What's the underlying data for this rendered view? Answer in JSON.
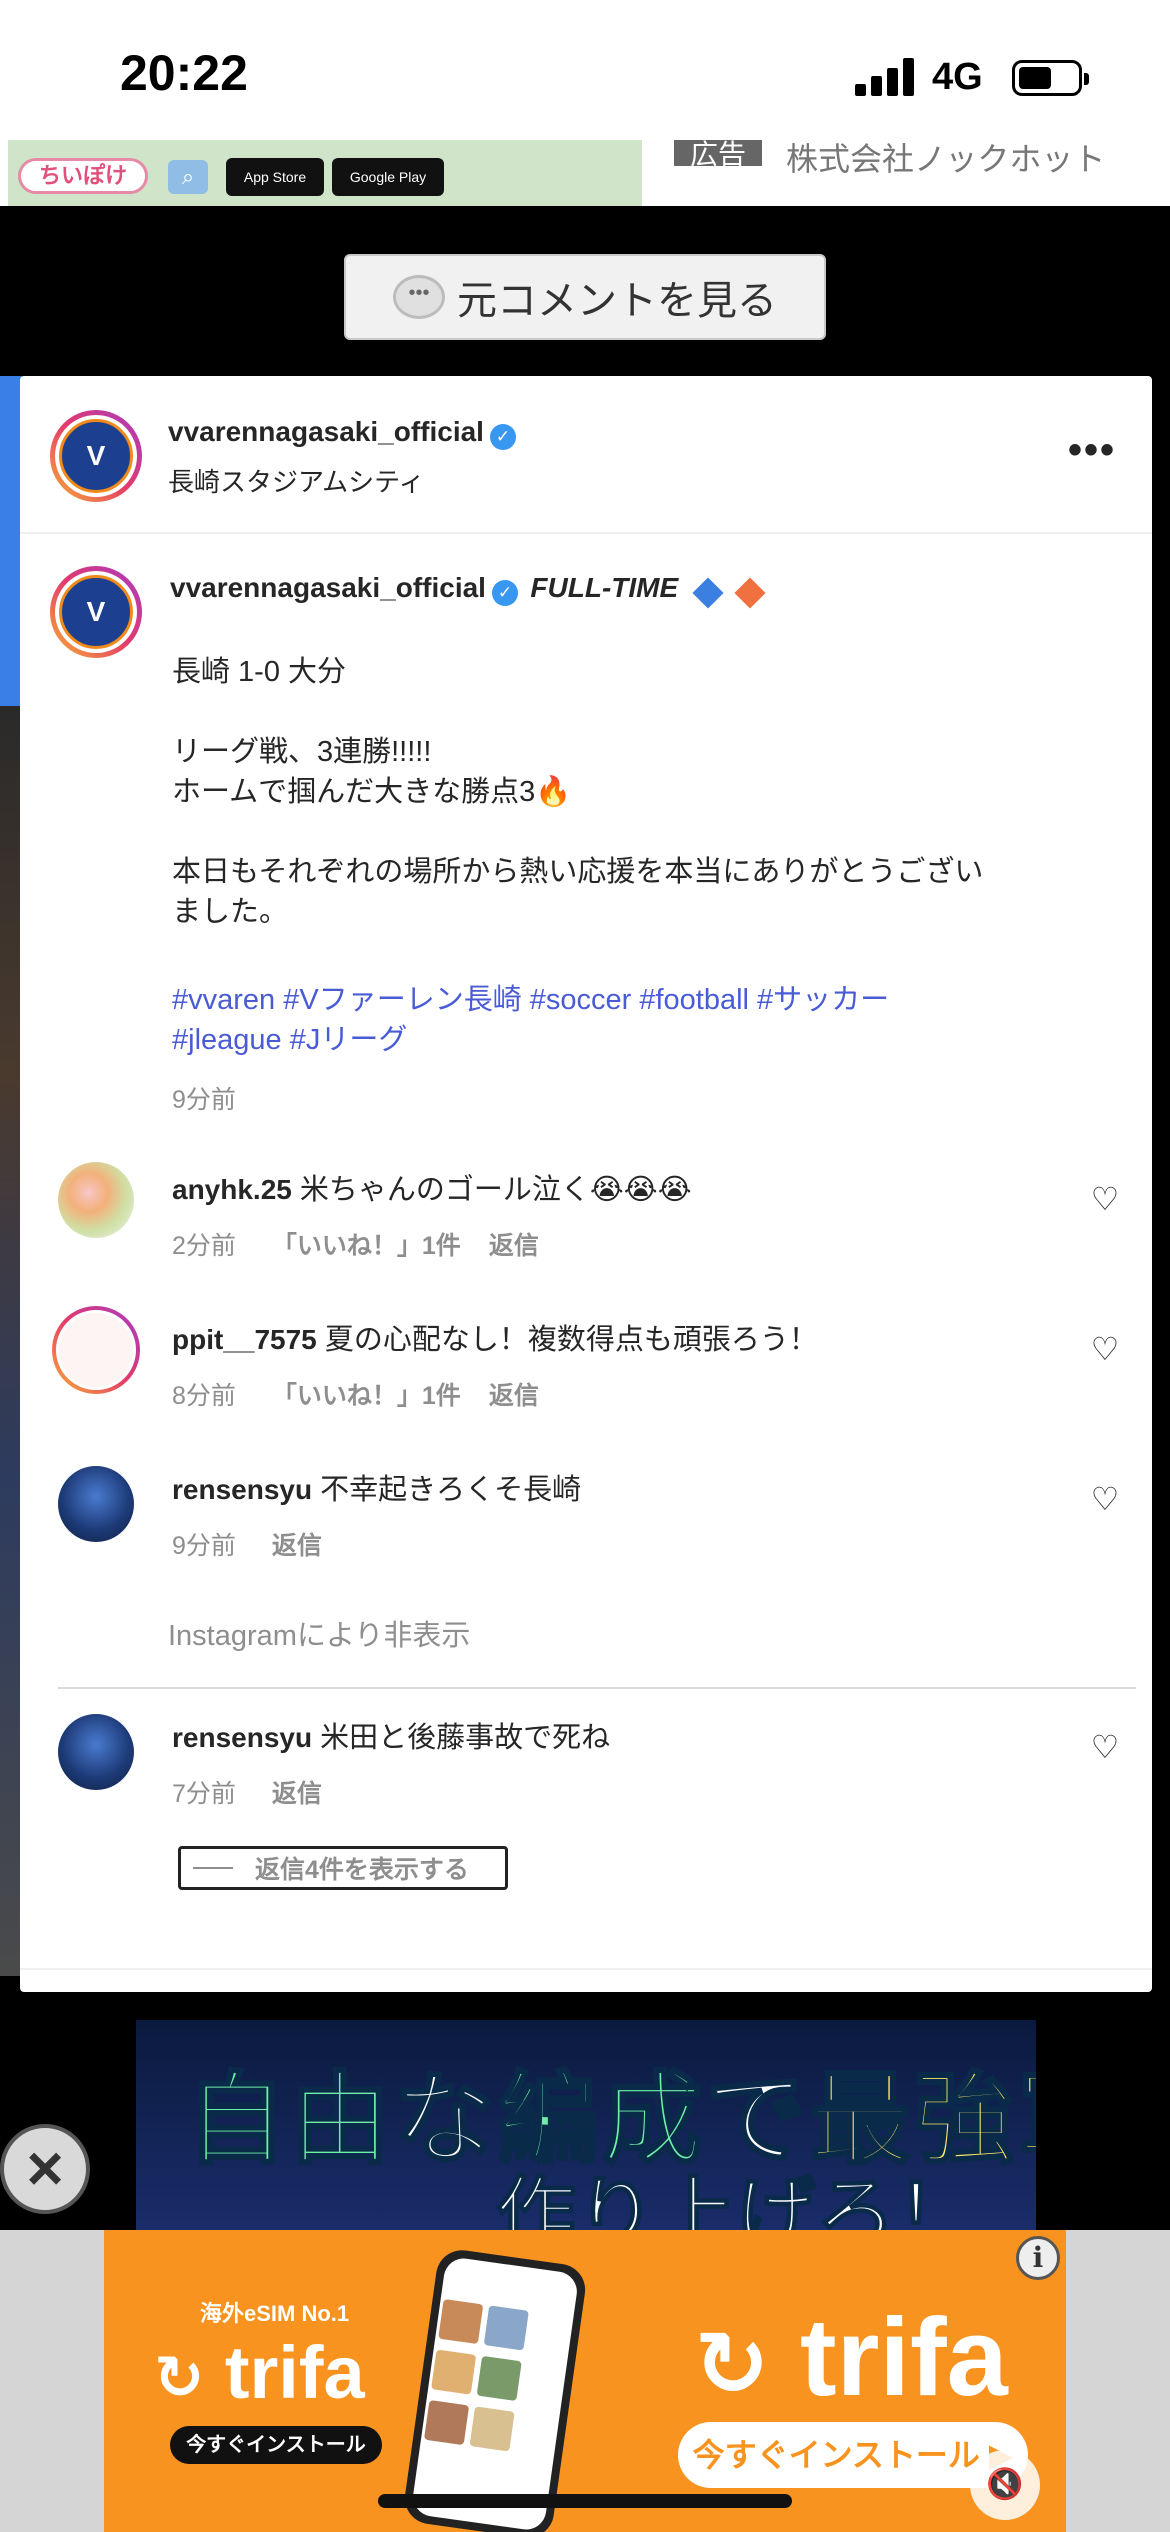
{
  "status_bar": {
    "time": "20:22",
    "network": "4G"
  },
  "top_ad": {
    "brand": "ちいぽけ",
    "store1": "App Store",
    "store2": "Google Play",
    "ad_label": "広告",
    "advertiser": "株式会社ノックホット"
  },
  "original_comment_button": "元コメントを見る",
  "post": {
    "author": "vvarennagasaki_official",
    "location": "長崎スタジアムシティ",
    "more": "•••",
    "caption_header": "FULL-TIME",
    "caption_body": "長崎 1-0 大分\n\nリーグ戦、3連勝!!!!!\nホームで掴んだ大きな勝点3🔥\n\n本日もそれぞれの場所から熱い応援を本当にありがとうござい\nました。",
    "hashtags_line1": "#vvaren #Vファーレン長崎 #soccer #football #サッカー",
    "hashtags_line2": "#jleague #Jリーグ",
    "time": "9分前"
  },
  "comments": [
    {
      "user": "anyhk.25",
      "text": "米ちゃんのゴール泣く😭😭😭",
      "time": "2分前",
      "likes": "「いいね！」1件",
      "reply": "返信"
    },
    {
      "user": "ppit__7575",
      "text": "夏の心配なし！複数得点も頑張ろう！",
      "time": "8分前",
      "likes": "「いいね！」1件",
      "reply": "返信"
    },
    {
      "user": "rensensyu",
      "text": "不幸起きろくそ長崎",
      "time": "9分前",
      "reply": "返信"
    },
    {
      "user": "rensensyu",
      "text": "米田と後藤事故で死ね",
      "time": "7分前",
      "reply": "返信"
    }
  ],
  "hidden_notice": "Instagramにより非表示",
  "view_replies": "返信4件を表示する",
  "game_ad": {
    "line1a": "自由",
    "line1b": "な",
    "line1c": "編成",
    "line1d": "で",
    "line1e": "最強軍",
    "line2": "作り上げろ！"
  },
  "trifa_ad": {
    "tagline": "海外eSIM No.1",
    "brand": "trifa",
    "install_small": "今すぐインストール",
    "install_big": "今すぐインストール ▶"
  }
}
